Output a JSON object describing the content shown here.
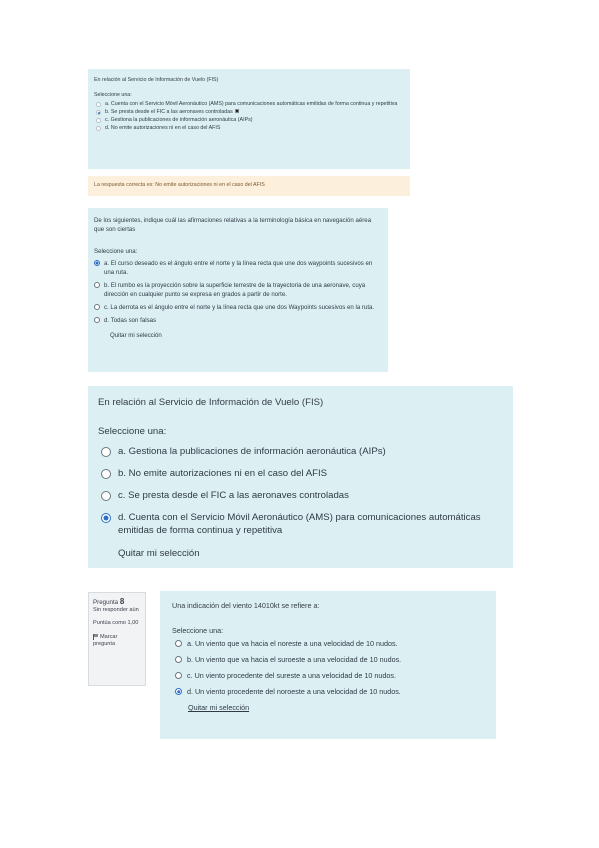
{
  "q1": {
    "prompt": "En relación al Servicio de Información de Vuelo (FIS)",
    "select_label": "Seleccione una:",
    "options": [
      "a. Cuenta con el Servicio Móvil Aeronáutico (AMS) para comunicaciones automáticas emitidas de forma continua y repetitiva",
      "b. Se presta desde el FIC a las aeronaves controladas",
      "c. Gestiona la publicaciones de información aeronáutica (AIPs)",
      "d. No emite autorizaciones ni en el caso del AFIS"
    ],
    "selected_index": 1,
    "wrong_mark": "✖",
    "feedback": "La respuesta correcta es: No emite autorizaciones ni en el caso del AFIS"
  },
  "q2": {
    "prompt": "De los siguientes, indique cuál las afirmaciones relativas a la terminología básica en navegación aérea que son ciertas",
    "select_label": "Seleccione una:",
    "options": [
      "a. El curso deseado es el ángulo entre el norte y la línea recta que une dos waypoints sucesivos en una ruta.",
      "b. El rumbo es la proyección sobre la superficie terrestre de la trayectoria de una aeronave, cuya dirección en cualquier punto se expresa en grados a partir de norte.",
      "c. La derrota es el ángulo entre el norte y la línea recta que une dos Waypoints sucesivos en la ruta.",
      "d. Todas son falsas"
    ],
    "selected_index": 0,
    "clear_label": "Quitar mi selección"
  },
  "q3": {
    "prompt": "En relación al Servicio de Información de Vuelo (FIS)",
    "select_label": "Seleccione una:",
    "options": [
      "a. Gestiona la publicaciones de información aeronáutica (AIPs)",
      "b. No emite autorizaciones ni en el caso del AFIS",
      "c. Se presta desde el FIC a las aeronaves controladas",
      "d. Cuenta con el Servicio Móvil Aeronáutico (AMS) para comunicaciones automáticas emitidas de forma continua y repetitiva"
    ],
    "selected_index": 3,
    "clear_label": "Quitar mi selección"
  },
  "info4": {
    "question_label": "Pregunta",
    "question_number": "8",
    "status": "Sin responder aún",
    "points": "Puntúa como 1,00",
    "flag_label": "Marcar pregunta"
  },
  "q4": {
    "prompt": "Una indicación del viento 14010kt se refiere a:",
    "select_label": "Seleccione una:",
    "options": [
      "a. Un viento que va hacia el noreste a una velocidad de 10 nudos.",
      "b. Un viento que va hacia el suroeste a una velocidad de 10 nudos.",
      "c. Un viento procedente del sureste a una velocidad de 10 nudos.",
      "d. Un viento procedente del noroeste a una velocidad de 10 nudos."
    ],
    "selected_index": 3,
    "clear_label": "Quitar mi selección"
  }
}
